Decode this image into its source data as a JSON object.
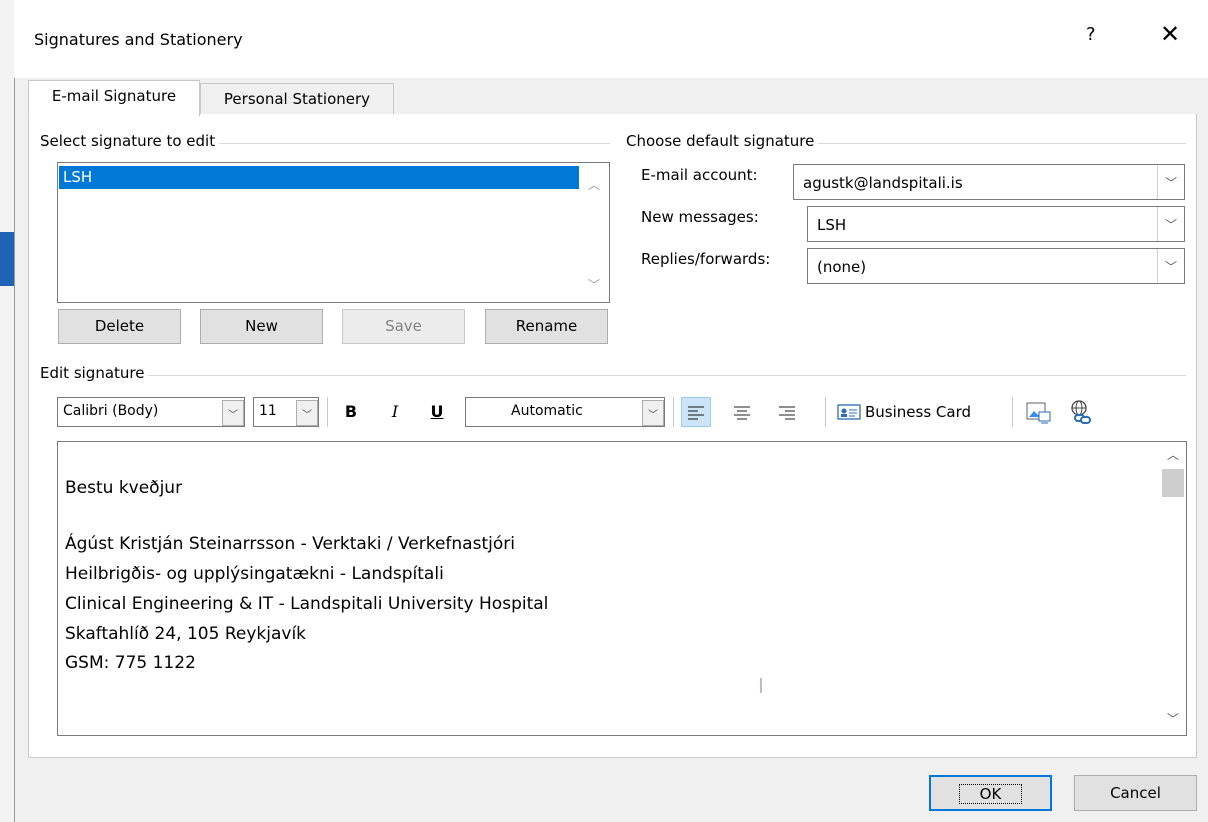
{
  "dialog": {
    "title": "Signatures and Stationery",
    "help": "?",
    "close": "✕"
  },
  "tabs": [
    "E-mail Signature",
    "Personal Stationery"
  ],
  "select_signature": {
    "label": "Select signature to edit",
    "items": [
      "LSH"
    ],
    "selected": "LSH"
  },
  "buttons": {
    "delete": "Delete",
    "new": "New",
    "save": "Save",
    "rename": "Rename"
  },
  "default_signature": {
    "label": "Choose default signature",
    "email_account_label": "E-mail account:",
    "email_account_value": "agustk@landspitali.is",
    "new_messages_label": "New messages:",
    "new_messages_value": "LSH",
    "replies_label": "Replies/forwards:",
    "replies_value": "(none)"
  },
  "edit_signature": {
    "label": "Edit signature",
    "font": "Calibri (Body)",
    "size": "11",
    "bold": "B",
    "italic": "I",
    "underline": "U",
    "color": "Automatic",
    "business_card": "Business Card",
    "lines": [
      "Bestu kveðjur",
      "",
      "Ágúst Kristján Steinarrsson - Verktaki / Verkefnastjóri",
      "Heilbrigðis- og upplýsingatækni - Landspítali",
      "Clinical Engineering & IT - Landspitali University Hospital",
      "Skaftahlíð 24, 105 Reykjavík",
      "GSM: 775 1122"
    ]
  },
  "footer": {
    "ok": "OK",
    "cancel": "Cancel"
  },
  "colors": {
    "accent": "#0078d7",
    "selection": "#0078d7"
  }
}
